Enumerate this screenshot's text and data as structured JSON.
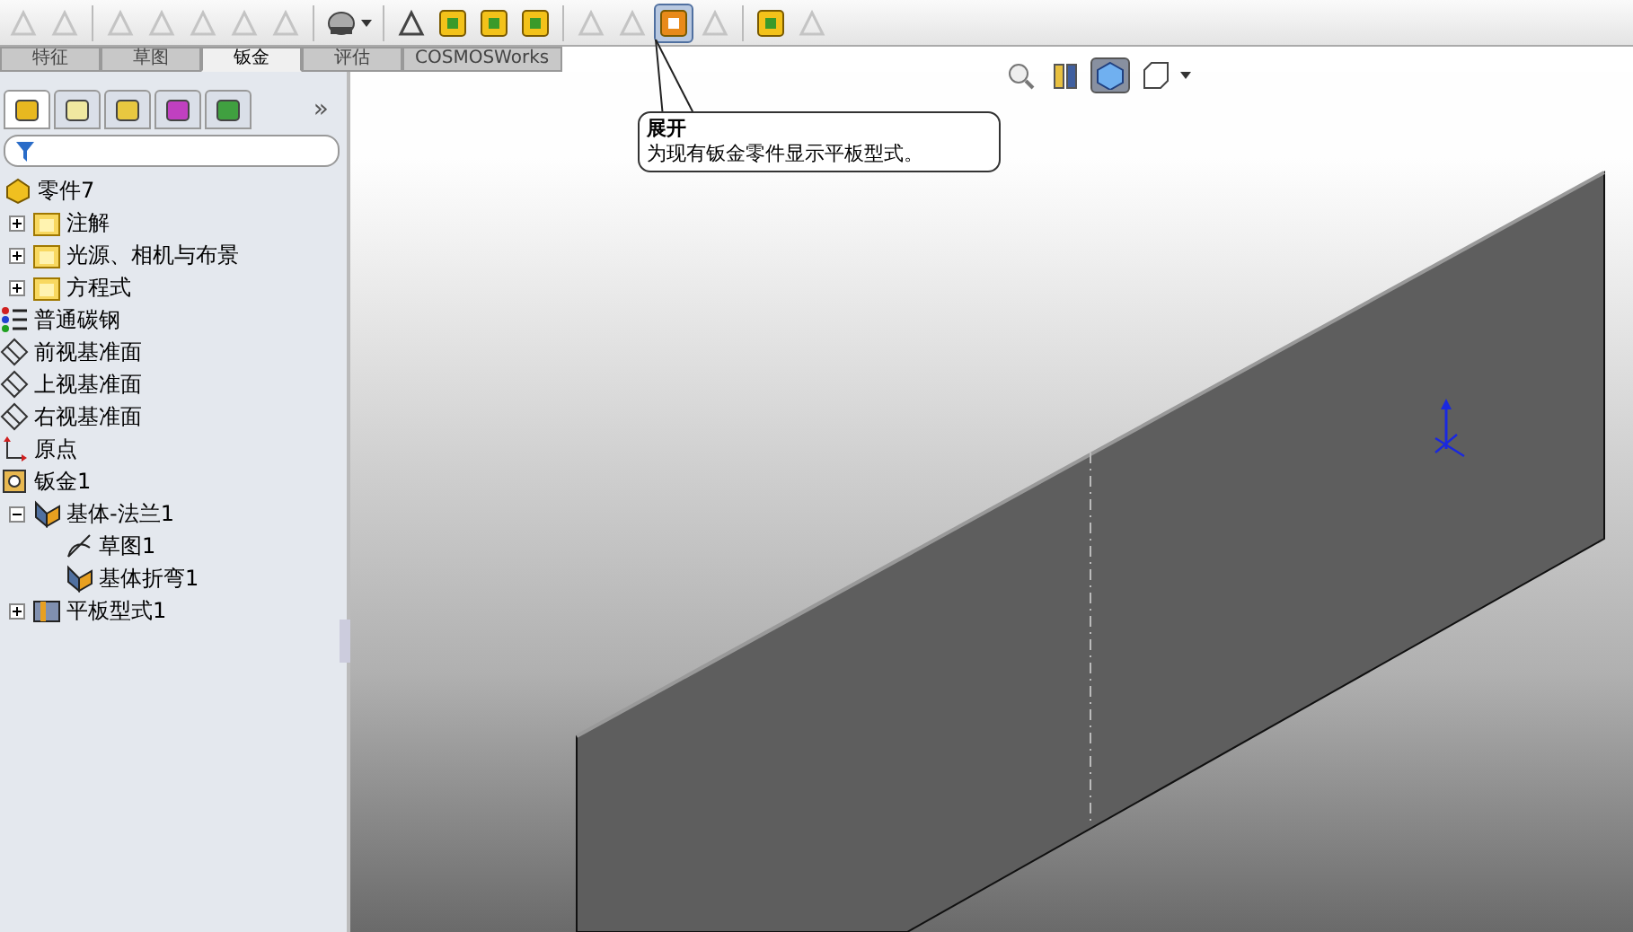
{
  "toolbar": [
    {
      "kind": "icon",
      "disabled": true,
      "selected": false
    },
    {
      "kind": "icon",
      "disabled": true,
      "selected": false
    },
    {
      "kind": "separator"
    },
    {
      "kind": "icon",
      "disabled": true,
      "selected": false
    },
    {
      "kind": "icon",
      "disabled": true,
      "selected": false
    },
    {
      "kind": "icon",
      "disabled": true,
      "selected": false
    },
    {
      "kind": "icon",
      "disabled": true,
      "selected": false
    },
    {
      "kind": "icon",
      "disabled": true,
      "selected": false
    },
    {
      "kind": "separator"
    },
    {
      "kind": "dropdown",
      "disabled": false,
      "selected": false
    },
    {
      "kind": "separator"
    },
    {
      "kind": "icon",
      "disabled": false,
      "selected": false
    },
    {
      "kind": "box",
      "disabled": false,
      "selected": false
    },
    {
      "kind": "box",
      "disabled": false,
      "selected": false
    },
    {
      "kind": "box",
      "disabled": false,
      "selected": false
    },
    {
      "kind": "separator"
    },
    {
      "kind": "icon",
      "disabled": true,
      "selected": false
    },
    {
      "kind": "icon",
      "disabled": true,
      "selected": false
    },
    {
      "kind": "box",
      "disabled": false,
      "selected": true
    },
    {
      "kind": "icon",
      "disabled": true,
      "selected": false
    },
    {
      "kind": "separator"
    },
    {
      "kind": "box",
      "disabled": false,
      "selected": false
    },
    {
      "kind": "icon",
      "disabled": true,
      "selected": false
    }
  ],
  "command_tabs": [
    {
      "label": "特征",
      "selected": false
    },
    {
      "label": "草图",
      "selected": false
    },
    {
      "label": "钣金",
      "selected": true
    },
    {
      "label": "评估",
      "selected": false
    },
    {
      "label": "COSMOSWorks",
      "selected": false
    }
  ],
  "panel_tabs": [
    {
      "selected": true
    },
    {
      "selected": false
    },
    {
      "selected": false
    },
    {
      "selected": false
    },
    {
      "selected": false
    }
  ],
  "panel_more": "»",
  "tree": {
    "label": "零件7",
    "kind": "part",
    "children": [
      {
        "label": "注解",
        "kind": "folder",
        "expanded": false
      },
      {
        "label": "光源、相机与布景",
        "kind": "folder",
        "expanded": false
      },
      {
        "label": "方程式",
        "kind": "folder",
        "expanded": false
      },
      {
        "label": "普通碳钢",
        "kind": "material"
      },
      {
        "label": "前视基准面",
        "kind": "plane"
      },
      {
        "label": "上视基准面",
        "kind": "plane"
      },
      {
        "label": "右视基准面",
        "kind": "plane"
      },
      {
        "label": "原点",
        "kind": "origin"
      },
      {
        "label": "钣金1",
        "kind": "feature"
      },
      {
        "label": "基体-法兰1",
        "kind": "flange",
        "expanded": true,
        "children": [
          {
            "label": "草图1",
            "kind": "sketch"
          },
          {
            "label": "基体折弯1",
            "kind": "flange"
          }
        ]
      },
      {
        "label": "平板型式1",
        "kind": "flat",
        "expanded": false
      }
    ]
  },
  "view_toolbar": [
    {
      "selected": false
    },
    {
      "selected": false
    },
    {
      "selected": true
    },
    {
      "selected": false
    }
  ],
  "tooltip": {
    "title": "展开",
    "text": "为现有钣金零件显示平板型式。"
  }
}
